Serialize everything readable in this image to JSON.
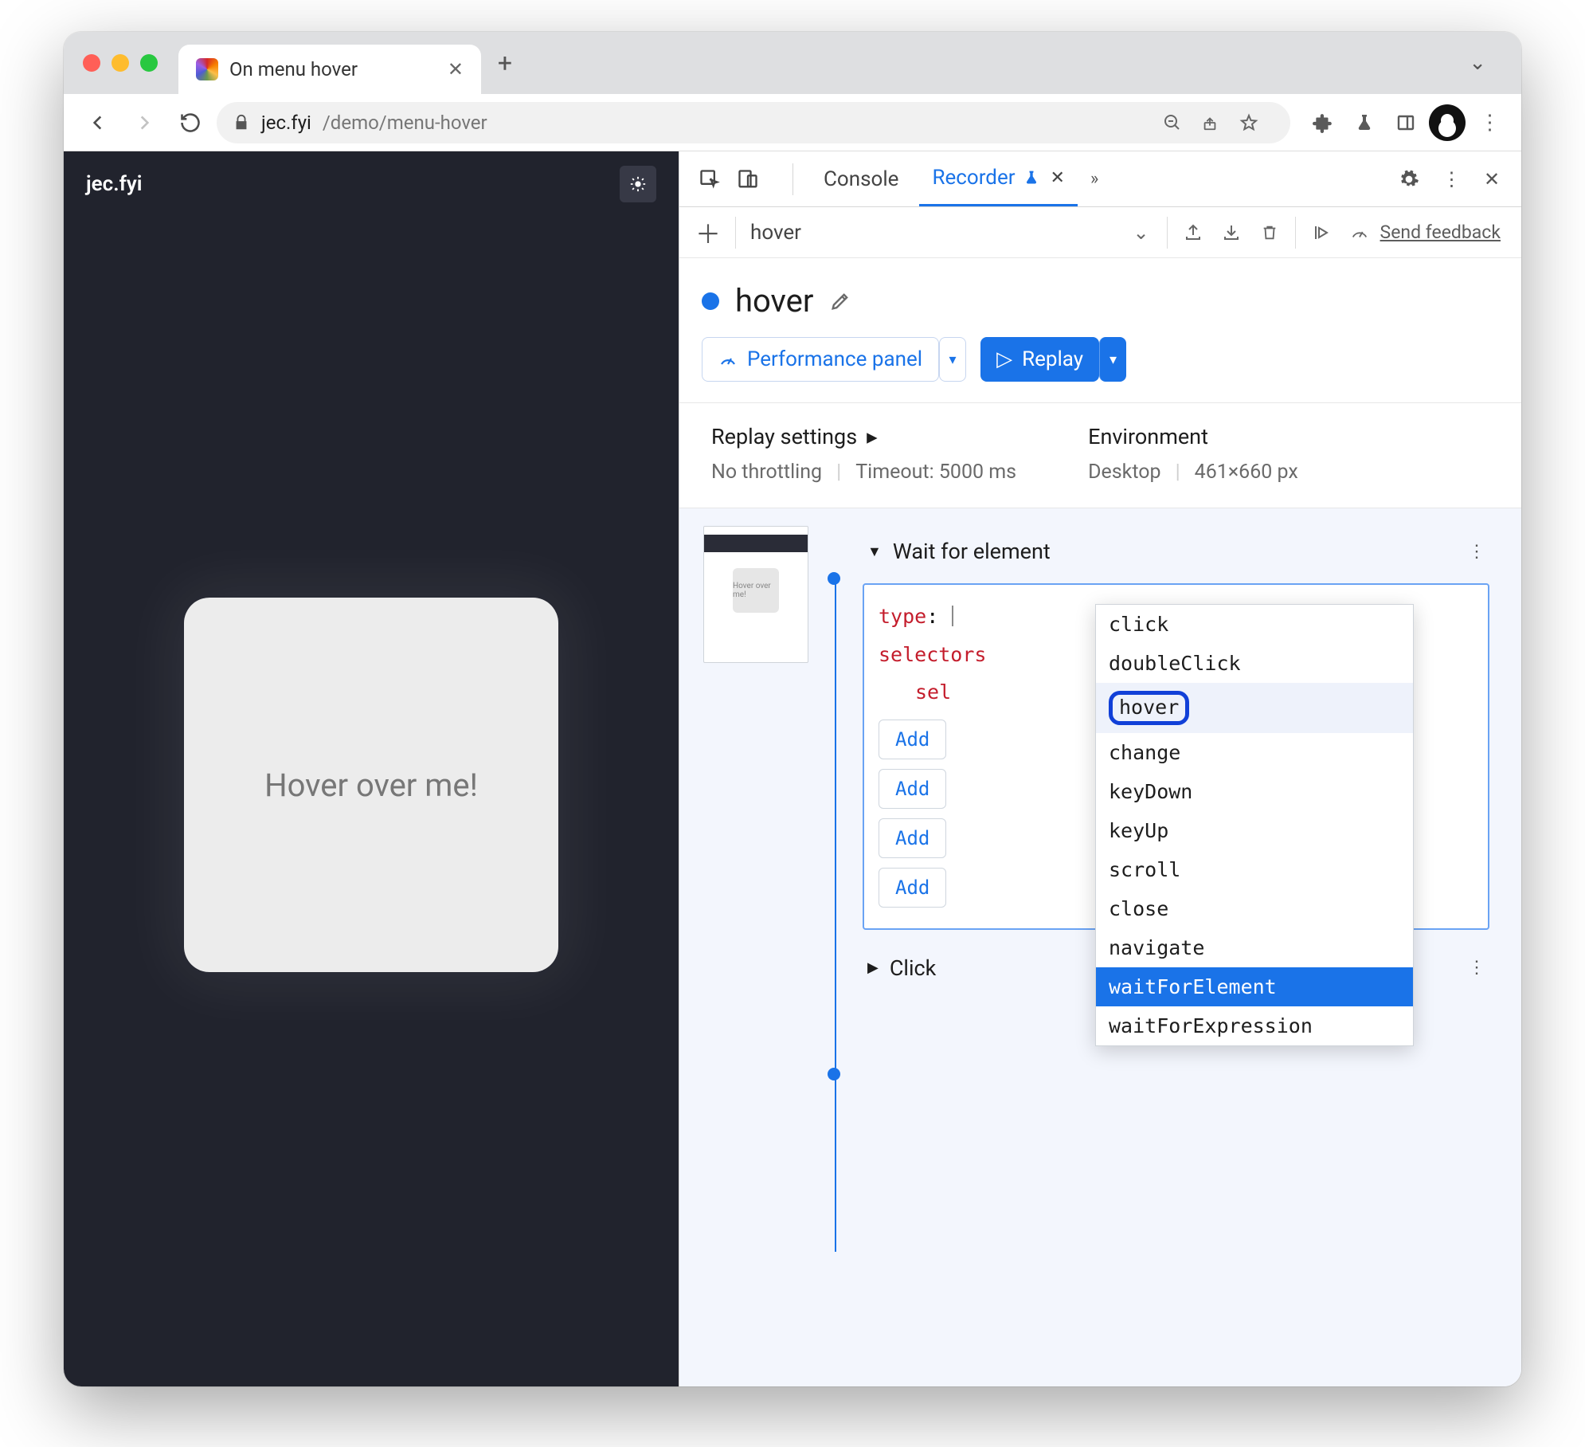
{
  "browser": {
    "tab_title": "On menu hover",
    "url_domain": "jec.fyi",
    "url_path": "/demo/menu-hover"
  },
  "page": {
    "site_title": "jec.fyi",
    "hover_text": "Hover over me!"
  },
  "devtools": {
    "tabs": {
      "console": "Console",
      "recorder": "Recorder"
    },
    "recording_name": "hover",
    "title": "hover",
    "feedback": "Send feedback",
    "actions": {
      "performance": "Performance panel",
      "replay": "Replay"
    },
    "settings": {
      "replay_label": "Replay settings",
      "no_throttling": "No throttling",
      "timeout": "Timeout: 5000 ms",
      "env_label": "Environment",
      "env_device": "Desktop",
      "env_vp": "461×660 px"
    },
    "thumb_label": "Hover over me!",
    "step_wait": "Wait for element",
    "editor": {
      "type_key": "type",
      "selectors_key": "selectors",
      "sel_abbrev": "sel"
    },
    "add_label": "Add",
    "dropdown_options": [
      "click",
      "doubleClick",
      "hover",
      "change",
      "keyDown",
      "keyUp",
      "scroll",
      "close",
      "navigate",
      "waitForElement",
      "waitForExpression"
    ],
    "step_click": "Click"
  }
}
